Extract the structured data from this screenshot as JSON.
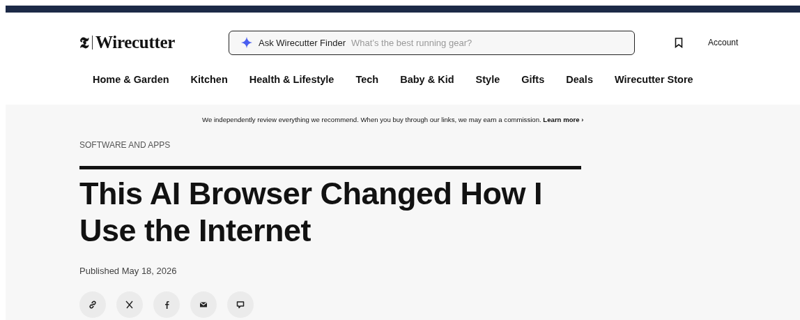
{
  "header": {
    "logo_mark": "𝕿",
    "logo": "Wirecutter",
    "search": {
      "label": "Ask Wirecutter Finder",
      "placeholder": "What’s the best running gear?"
    },
    "account": "Account"
  },
  "nav": [
    "Home & Garden",
    "Kitchen",
    "Health & Lifestyle",
    "Tech",
    "Baby & Kid",
    "Style",
    "Gifts",
    "Deals",
    "Wirecutter Store"
  ],
  "disclaimer": {
    "text": "We independently review everything we recommend. When you buy through our links, we may earn a commission.",
    "link": "Learn more ›"
  },
  "article": {
    "category": "SOFTWARE AND APPS",
    "title": "This AI Browser Changed How I Use the Internet",
    "published": "Published May 18, 2026"
  },
  "share": [
    {
      "kind": "link"
    },
    {
      "kind": "x"
    },
    {
      "kind": "facebook"
    },
    {
      "kind": "email"
    },
    {
      "kind": "comment"
    }
  ]
}
